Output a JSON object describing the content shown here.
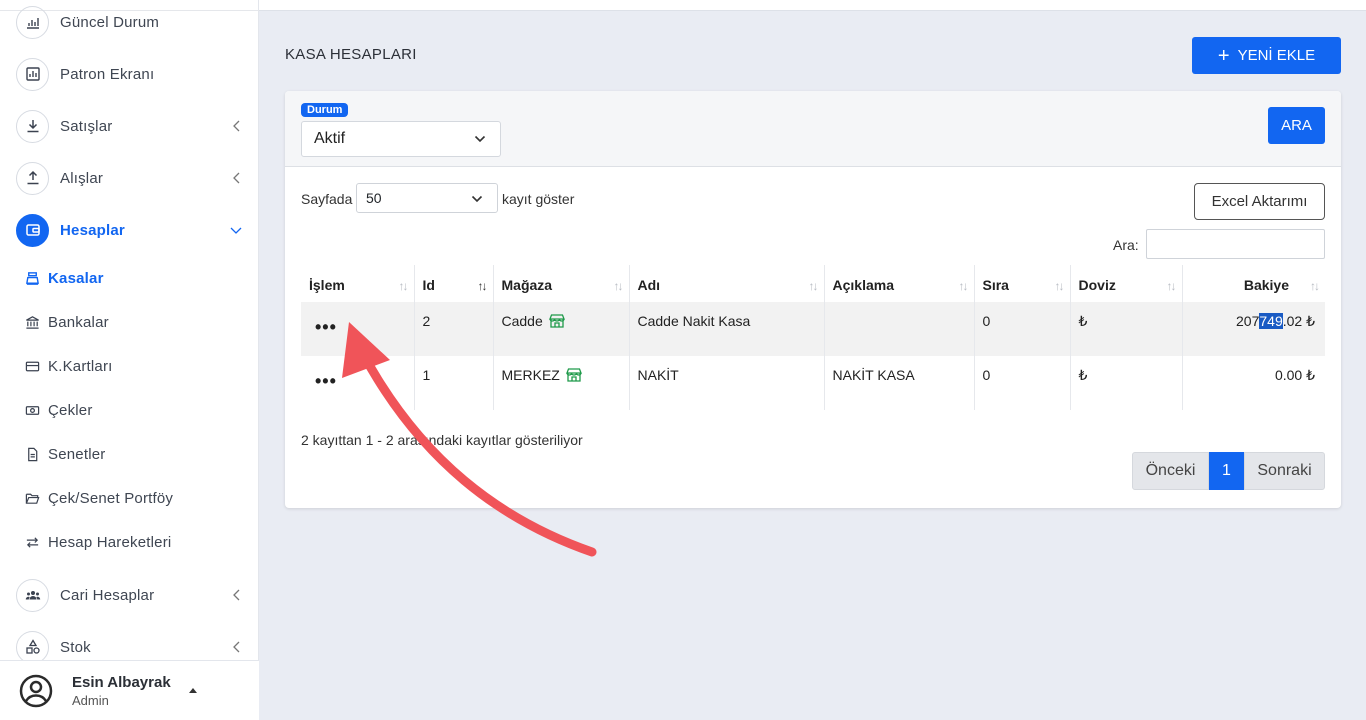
{
  "sidebar": {
    "items": [
      {
        "label": "Güncel Durum",
        "icon": "chart-icon"
      },
      {
        "label": "Patron Ekranı",
        "icon": "bar-chart-icon"
      },
      {
        "label": "Satışlar",
        "icon": "download-icon"
      },
      {
        "label": "Alışlar",
        "icon": "upload-icon"
      },
      {
        "label": "Hesaplar",
        "icon": "wallet-icon"
      },
      {
        "label": "Cari Hesaplar",
        "icon": "users-icon"
      },
      {
        "label": "Stok",
        "icon": "shapes-icon"
      }
    ],
    "sub_items": [
      {
        "label": "Kasalar",
        "icon": "cash-register-icon"
      },
      {
        "label": "Bankalar",
        "icon": "bank-icon"
      },
      {
        "label": "K.Kartları",
        "icon": "credit-card-icon"
      },
      {
        "label": "Çekler",
        "icon": "money-icon"
      },
      {
        "label": "Senetler",
        "icon": "document-icon"
      },
      {
        "label": "Çek/Senet Portföy",
        "icon": "folder-open-icon"
      },
      {
        "label": "Hesap Hareketleri",
        "icon": "exchange-icon"
      }
    ]
  },
  "user": {
    "name": "Esin Albayrak",
    "role": "Admin"
  },
  "page": {
    "title": "KASA HESAPLARI",
    "add_button": "YENİ EKLE"
  },
  "filter": {
    "badge": "Durum",
    "status_value": "Aktif",
    "search_button": "ARA"
  },
  "list_controls": {
    "show_prefix": "Sayfada",
    "page_size": "50",
    "show_suffix": "kayıt göster",
    "excel_button": "Excel Aktarımı",
    "search_label": "Ara:"
  },
  "table": {
    "headers": [
      "İşlem",
      "Id",
      "Mağaza",
      "Adı",
      "Açıklama",
      "Sıra",
      "Doviz",
      "Bakiye"
    ],
    "rows": [
      {
        "action": "•••",
        "id": "2",
        "store": "Cadde",
        "name": "Cadde Nakit Kasa",
        "description": "",
        "order": "0",
        "currency": "₺",
        "balance_pre": "207",
        "balance_sel": "749",
        "balance_post": ".02 ₺"
      },
      {
        "action": "•••",
        "id": "1",
        "store": "MERKEZ",
        "name": "NAKİT",
        "description": "NAKİT KASA",
        "order": "0",
        "currency": "₺",
        "balance_pre": "0.00 ₺",
        "balance_sel": "",
        "balance_post": ""
      }
    ]
  },
  "footer": {
    "info": "2 kayıttan 1 - 2 arasındaki kayıtlar gösteriliyor",
    "prev": "Önceki",
    "current": "1",
    "next": "Sonraki"
  },
  "colors": {
    "accent": "#1266f1",
    "annotation_arrow": "#f05459",
    "store_icon": "#1f9a4a"
  }
}
